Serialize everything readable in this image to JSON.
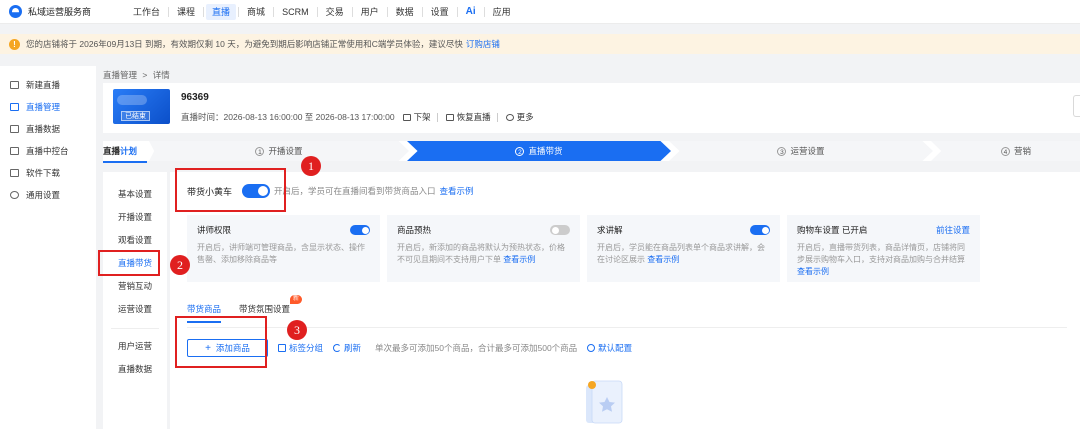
{
  "app": {
    "name": "私域运营服务商"
  },
  "top_nav": {
    "items": [
      "工作台",
      "课程",
      "直播",
      "商城",
      "SCRM",
      "交易",
      "用户",
      "数据",
      "设置",
      "Ai",
      "应用"
    ],
    "active": "直播"
  },
  "notice": {
    "text": "您的店铺将于 2026年09月13日 到期，有效期仅剩 10 天，为避免到期后影响店铺正常使用和C端学员体验，建议尽快",
    "link": "订购店铺",
    "icon": "warning-icon"
  },
  "sidebar": {
    "items": [
      {
        "label": "新建直播",
        "icon": "new-live-icon"
      },
      {
        "label": "直播管理",
        "icon": "live-manage-icon"
      },
      {
        "label": "直播数据",
        "icon": "live-data-icon"
      },
      {
        "label": "直播中控台",
        "icon": "console-icon"
      },
      {
        "label": "软件下载",
        "icon": "download-icon"
      },
      {
        "label": "通用设置",
        "icon": "settings-icon"
      }
    ],
    "active_index": 1
  },
  "breadcrumb": {
    "parent": "直播管理",
    "sep": ">",
    "current": "详情"
  },
  "live": {
    "id": "96369",
    "status": "已结束",
    "time_label": "直播时间：",
    "time_range": "2026-08-13 16:00:00 至 2026-08-13 17:00:00",
    "actions": [
      "下架",
      "恢复直播",
      "更多"
    ]
  },
  "steps": {
    "label_prefix": "直播",
    "label_suffix": "计划",
    "items": [
      {
        "num": "1",
        "label": "开播设置"
      },
      {
        "num": "2",
        "label": "直播带货"
      },
      {
        "num": "3",
        "label": "运营设置"
      },
      {
        "num": "4",
        "label": "营销"
      }
    ],
    "active_index": 1
  },
  "sub_sidebar": {
    "items": [
      "基本设置",
      "开播设置",
      "观看设置",
      "直播带货",
      "营销互动",
      "运营设置"
    ],
    "items2": [
      "用户运营",
      "直播数据"
    ],
    "active": "直播带货"
  },
  "cart_toggle": {
    "label": "带货小黄车",
    "enabled": true,
    "desc": "开启后，学员可在直播间看到带货商品入口",
    "link": "查看示例"
  },
  "cards": [
    {
      "title": "讲师权限",
      "toggle": true,
      "desc": "开启后，讲师端可管理商品，含显示状态、操作售罄、添加移除商品等"
    },
    {
      "title": "商品预热",
      "toggle": false,
      "desc": "开启后，新添加的商品将默认为预热状态，价格不可见且期间不支持用户下单",
      "link": "查看示例"
    },
    {
      "title": "求讲解",
      "toggle": true,
      "desc": "开启后，学员能在商品列表单个商品求讲解，会在讨论区展示",
      "link": "查看示例"
    },
    {
      "title": "购物车设置",
      "status": "已开启",
      "action": "前往设置",
      "desc": "开启后，直播带货列表，商品详情页，店铺将同步展示购物车入口，支持对商品加购与合并结算",
      "link": "查看示例"
    }
  ],
  "tabs": {
    "items": [
      "带货商品",
      "带货氛围设置"
    ],
    "active_index": 0,
    "badge": "新"
  },
  "toolbar": {
    "add_button": "添加商品",
    "tag_group": "标签分组",
    "refresh": "刷新",
    "hint": "单次最多可添加50个商品，合计最多可添加500个商品",
    "default_config": "默认配置"
  },
  "annotations": [
    "1",
    "2",
    "3"
  ],
  "colors": {
    "accent": "#1a6ef2",
    "annotation": "#e02020",
    "notice_bg": "#fdf3e2"
  }
}
